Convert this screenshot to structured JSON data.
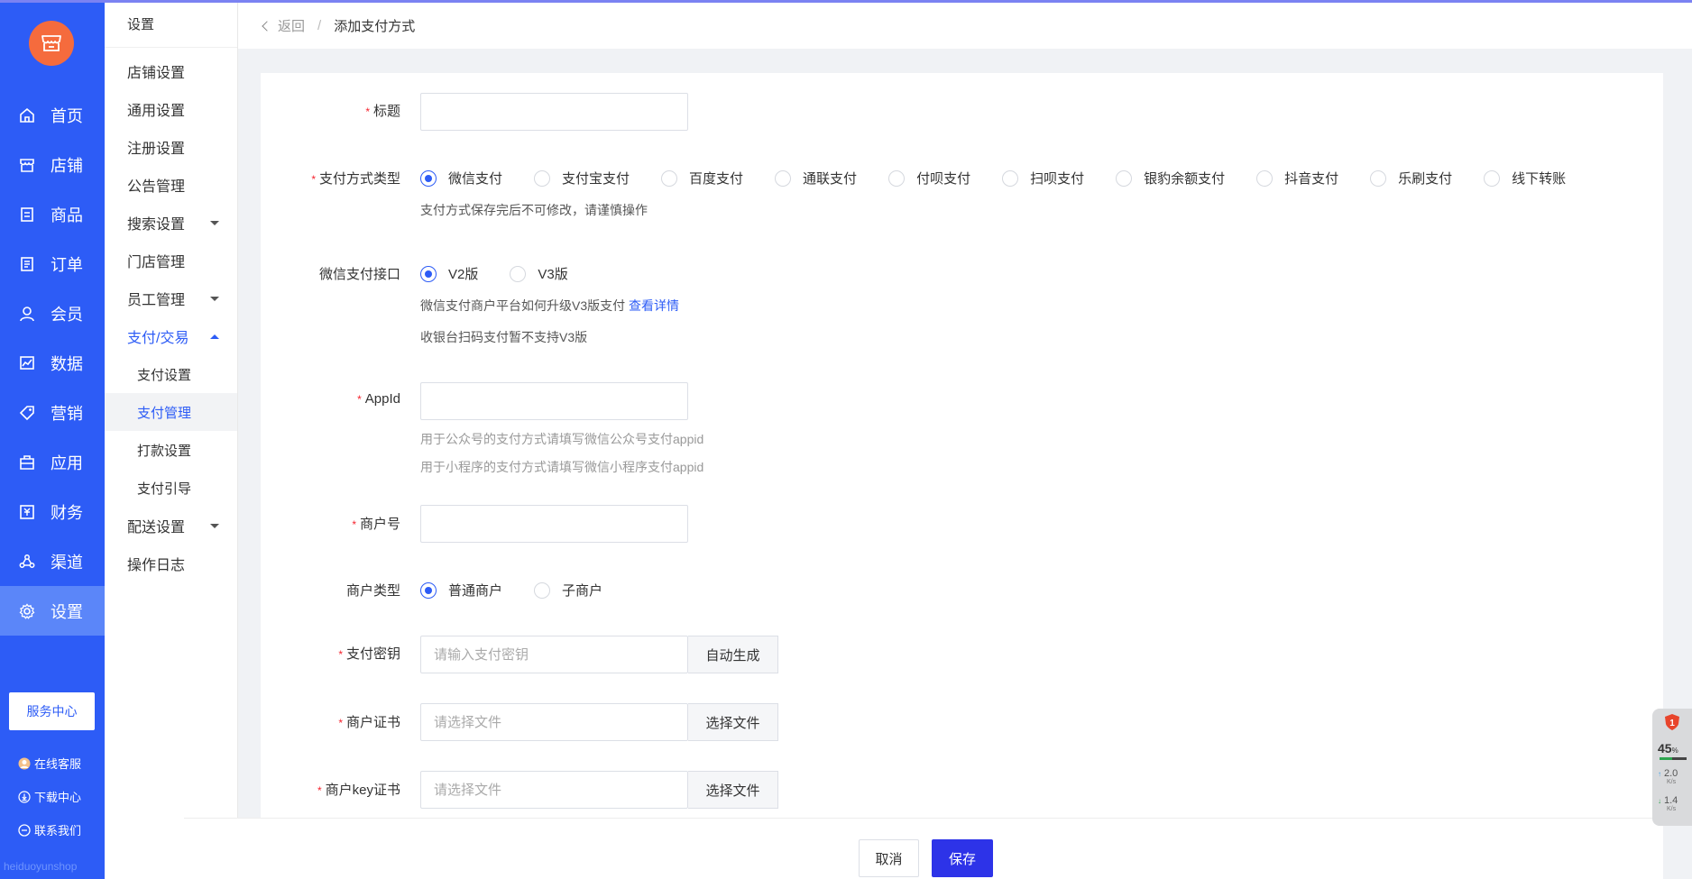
{
  "main_nav": {
    "items": [
      {
        "label": "首页",
        "icon": "home-icon"
      },
      {
        "label": "店铺",
        "icon": "shop-icon"
      },
      {
        "label": "商品",
        "icon": "goods-icon"
      },
      {
        "label": "订单",
        "icon": "order-icon"
      },
      {
        "label": "会员",
        "icon": "member-icon"
      },
      {
        "label": "数据",
        "icon": "chart-icon"
      },
      {
        "label": "营销",
        "icon": "tag-icon"
      },
      {
        "label": "应用",
        "icon": "app-icon"
      },
      {
        "label": "财务",
        "icon": "finance-icon"
      },
      {
        "label": "渠道",
        "icon": "channel-icon"
      },
      {
        "label": "设置",
        "icon": "gear-icon"
      }
    ],
    "active_index": 10,
    "service_center": "服务中心",
    "bottom_links": [
      {
        "label": "在线客服",
        "icon": "avatar-icon"
      },
      {
        "label": "下载中心",
        "icon": "download-icon"
      },
      {
        "label": "联系我们",
        "icon": "contact-icon"
      }
    ],
    "watermark": "heiduoyunshop"
  },
  "sec_nav": {
    "title": "设置",
    "items": [
      {
        "label": "店铺设置"
      },
      {
        "label": "通用设置"
      },
      {
        "label": "注册设置"
      },
      {
        "label": "公告管理"
      },
      {
        "label": "搜索设置"
      },
      {
        "label": "门店管理"
      },
      {
        "label": "员工管理"
      },
      {
        "label": "支付/交易"
      },
      {
        "label": "配送设置"
      },
      {
        "label": "操作日志"
      }
    ],
    "payment_sub": [
      {
        "label": "支付设置"
      },
      {
        "label": "支付管理"
      },
      {
        "label": "打款设置"
      },
      {
        "label": "支付引导"
      }
    ]
  },
  "header": {
    "back": "返回",
    "separator": "/",
    "title": "添加支付方式"
  },
  "form": {
    "title": {
      "label": "标题",
      "value": ""
    },
    "pay_type": {
      "label": "支付方式类型",
      "options": [
        "微信支付",
        "支付宝支付",
        "百度支付",
        "通联支付",
        "付呗支付",
        "扫呗支付",
        "银豹余额支付",
        "抖音支付",
        "乐刷支付",
        "线下转账"
      ],
      "selected": "微信支付",
      "help": "支付方式保存完后不可修改，请谨慎操作"
    },
    "wx_api": {
      "label": "微信支付接口",
      "options": [
        "V2版",
        "V3版"
      ],
      "selected": "V2版",
      "help1": "微信支付商户平台如何升级V3版支付",
      "help1_link": "查看详情",
      "help2": "收银台扫码支付暂不支持V3版"
    },
    "appid": {
      "label": "AppId",
      "value": "",
      "hint1": "用于公众号的支付方式请填写微信公众号支付appid",
      "hint2": "用于小程序的支付方式请填写微信小程序支付appid"
    },
    "merchant_no": {
      "label": "商户号",
      "value": ""
    },
    "merchant_type": {
      "label": "商户类型",
      "options": [
        "普通商户",
        "子商户"
      ],
      "selected": "普通商户"
    },
    "pay_secret": {
      "label": "支付密钥",
      "placeholder": "请输入支付密钥",
      "button": "自动生成"
    },
    "merchant_cert": {
      "label": "商户证书",
      "placeholder": "请选择文件",
      "button": "选择文件"
    },
    "merchant_key_cert": {
      "label": "商户key证书",
      "placeholder": "请选择文件",
      "button": "选择文件"
    }
  },
  "footer": {
    "cancel": "取消",
    "save": "保存"
  },
  "monitor": {
    "badge": "1",
    "percent": "45",
    "percent_unit": "%",
    "up": "2.0",
    "down": "1.4",
    "unit": "K/s"
  },
  "colors": {
    "primary": "#2d5cf6",
    "save_button": "#2d33e8",
    "logo": "#f56b3d",
    "required": "#f5222d"
  }
}
